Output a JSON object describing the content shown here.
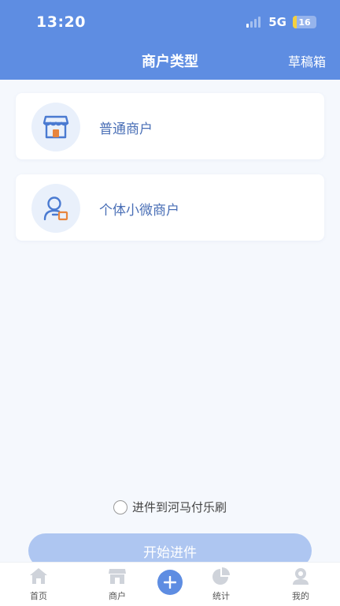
{
  "status_bar": {
    "time": "13:20",
    "network": "5G",
    "battery": "16"
  },
  "header": {
    "title": "商户类型",
    "draft_label": "草稿箱",
    "color": "#5e8de2"
  },
  "merchant_types": [
    {
      "label": "普通商户",
      "icon": "storefront-icon"
    },
    {
      "label": "个体小微商户",
      "icon": "person-card-icon"
    }
  ],
  "agreement": {
    "label": "进件到河马付乐刷",
    "checked": false
  },
  "start_button": {
    "label": "开始进件",
    "color": "#aec6f1"
  },
  "tabbar": {
    "home": "首页",
    "merchant": "商户",
    "stats": "统计",
    "mine": "我的"
  }
}
